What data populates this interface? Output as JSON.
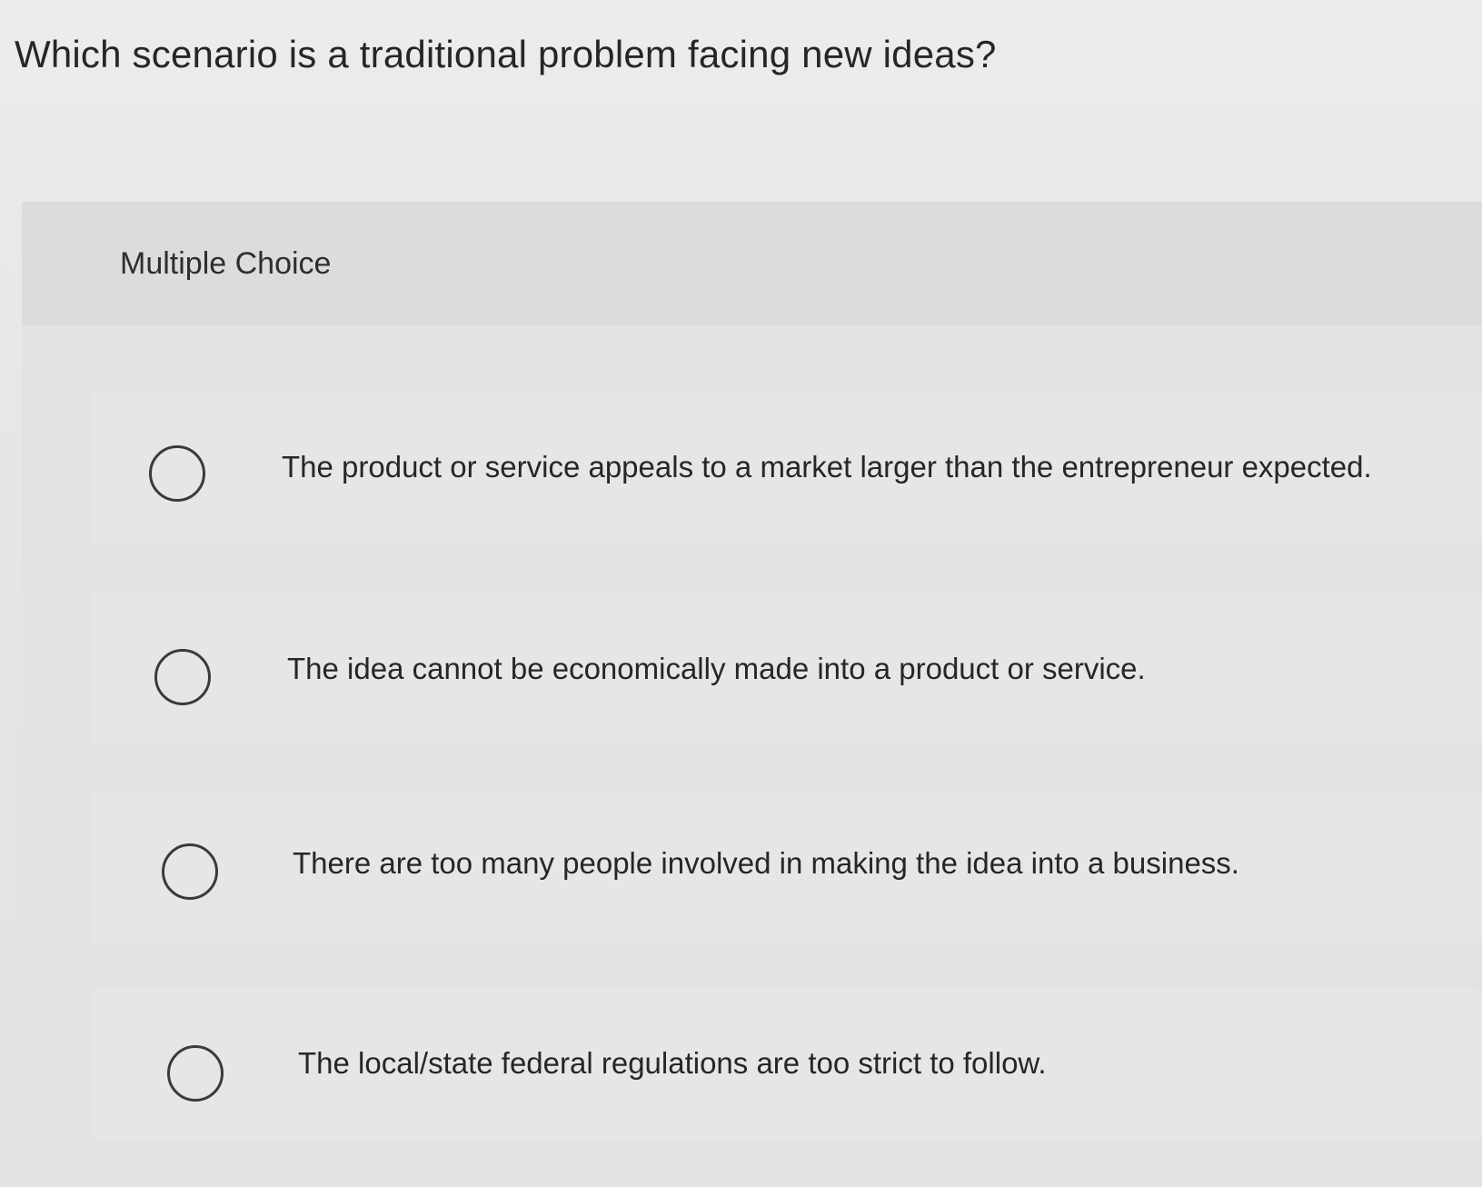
{
  "question": {
    "text": "Which scenario is a traditional problem facing new ideas?"
  },
  "panel": {
    "label": "Multiple Choice"
  },
  "options": [
    {
      "text": "The product or service appeals to a market larger than the entrepreneur expected.",
      "selected": false
    },
    {
      "text": "The idea cannot be economically made into a product or service.",
      "selected": false
    },
    {
      "text": "There are too many people involved in making the idea into a business.",
      "selected": false
    },
    {
      "text": "The local/state federal regulations are too strict to follow.",
      "selected": false
    }
  ],
  "colors": {
    "background": "#e8e8e8",
    "text": "#262626",
    "radio_border": "#3a3a3a"
  }
}
